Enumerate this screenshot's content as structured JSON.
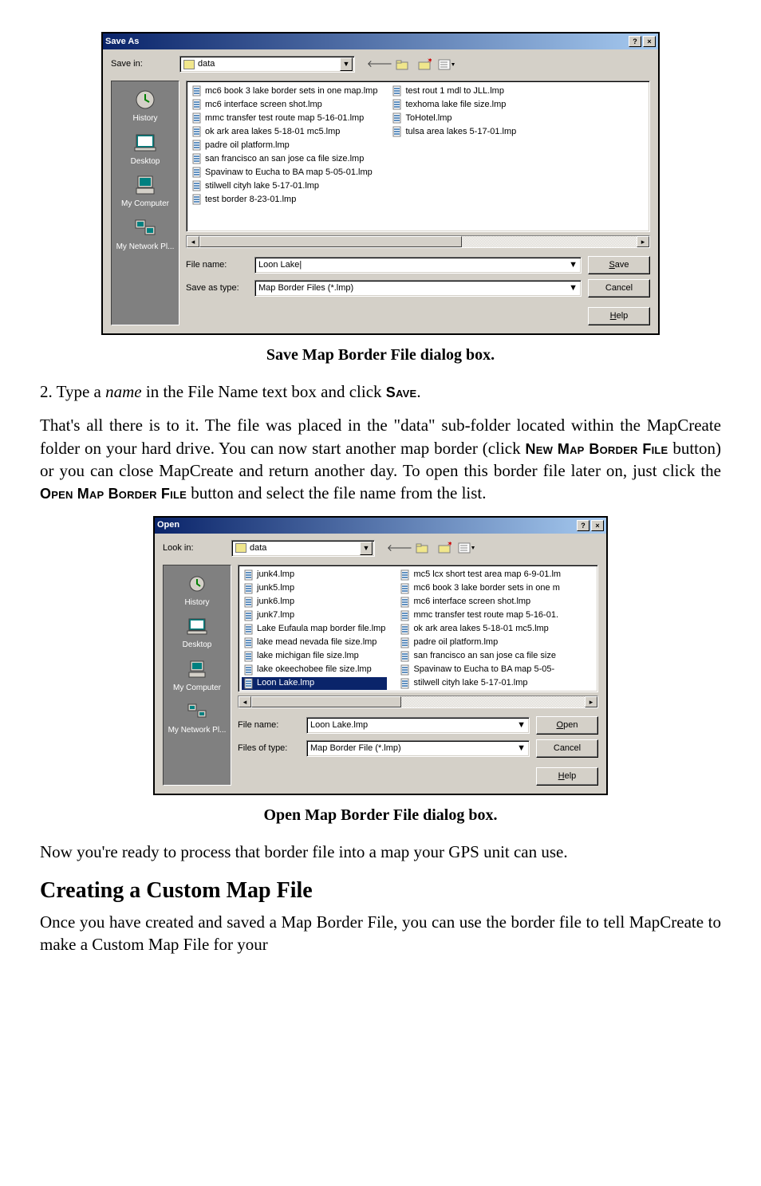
{
  "save_dialog": {
    "title": "Save As",
    "lookin_label": "Save in:",
    "lookin_value": "data",
    "places": [
      "History",
      "Desktop",
      "My Computer",
      "My Network Pl..."
    ],
    "files_col1": [
      "mc6 book 3 lake border sets in one map.lmp",
      "mc6 interface screen shot.lmp",
      "mmc transfer test route map 5-16-01.lmp",
      "ok ark area lakes 5-18-01 mc5.lmp",
      "padre oil platform.lmp",
      "san francisco an san jose ca file size.lmp",
      "Spavinaw to Eucha to BA map 5-05-01.lmp",
      "stilwell cityh lake 5-17-01.lmp",
      "test border 8-23-01.lmp"
    ],
    "files_col2": [
      "test rout 1 mdl to JLL.lmp",
      "texhoma lake file size.lmp",
      "ToHotel.lmp",
      "tulsa area lakes 5-17-01.lmp"
    ],
    "filename_label": "File name:",
    "filename_value": "Loon Lake",
    "type_label": "Save as type:",
    "type_value": "Map Border Files (*.lmp)",
    "save_btn": "Save",
    "cancel_btn": "Cancel",
    "help_btn": "Help"
  },
  "caption1": "Save Map Border File dialog box.",
  "step2": {
    "prefix": "2. Type a ",
    "name": "name",
    "mid": " in the File Name text box and click ",
    "save_sc": "Save",
    "end": "."
  },
  "para1a": "That's all there is to it. The file was placed in the \"data\" sub-folder located within the MapCreate folder on your hard drive. You can now start another map border (click ",
  "sc_newmap": "New Map Border File",
  "para1b": " button) or you can close MapCreate and return another day. To open this border file later on, just click the ",
  "sc_openmap": "Open Map Border File",
  "para1c": " button and select the file name from the list.",
  "open_dialog": {
    "title": "Open",
    "lookin_label": "Look in:",
    "lookin_value": "data",
    "places": [
      "History",
      "Desktop",
      "My Computer",
      "My Network Pl..."
    ],
    "files_col1": [
      "junk4.lmp",
      "junk5.lmp",
      "junk6.lmp",
      "junk7.lmp",
      "Lake Eufaula map border file.lmp",
      "lake mead nevada file size.lmp",
      "lake michigan file size.lmp",
      "lake okeechobee file size.lmp",
      "Loon Lake.lmp"
    ],
    "files_col2": [
      "mc5 lcx short test area map 6-9-01.lm",
      "mc6 book 3 lake border sets in one m",
      "mc6 interface screen shot.lmp",
      "mmc transfer test route map 5-16-01.",
      "ok ark area lakes 5-18-01 mc5.lmp",
      "padre oil platform.lmp",
      "san francisco an san jose ca file size",
      "Spavinaw to Eucha to BA map 5-05-",
      "stilwell cityh lake 5-17-01.lmp"
    ],
    "selected": "Loon Lake.lmp",
    "filename_label": "File name:",
    "filename_value": "Loon Lake.lmp",
    "type_label": "Files of type:",
    "type_value": "Map Border File (*.lmp)",
    "open_btn": "Open",
    "cancel_btn": "Cancel",
    "help_btn": "Help"
  },
  "caption2": "Open Map Border File dialog box.",
  "para2": "Now you're ready to process that border file into a map your GPS unit can use.",
  "heading": "Creating a Custom Map File",
  "para3": "Once you have created and saved a Map Border File, you can use the border file to tell MapCreate to make a Custom Map File for your"
}
